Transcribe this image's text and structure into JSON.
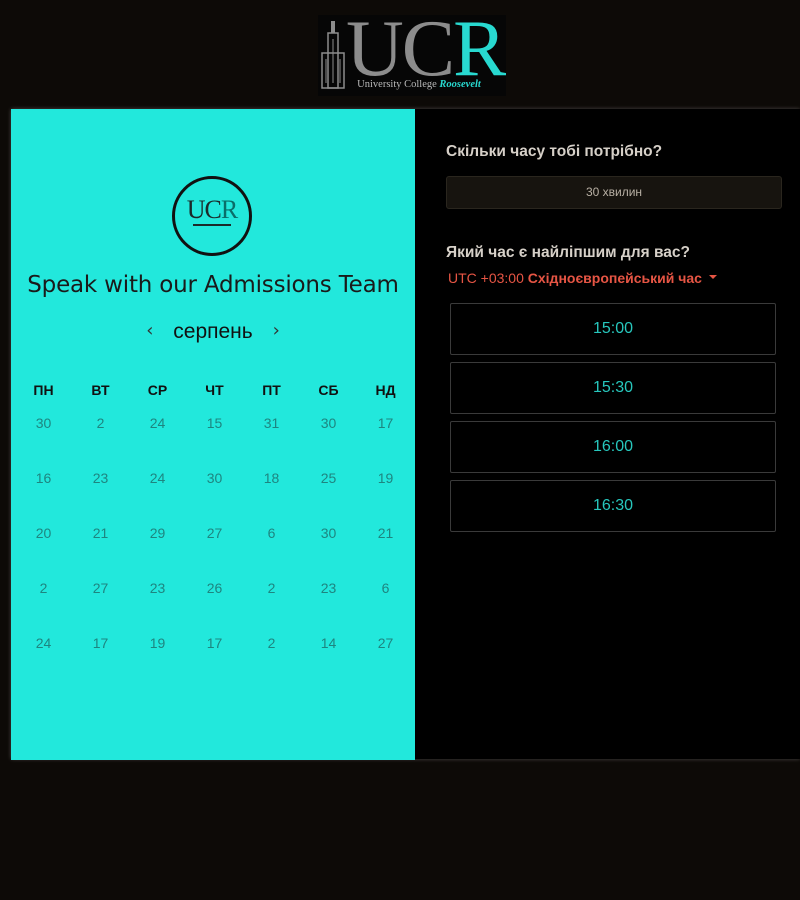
{
  "header": {
    "logo_letters_uc": "UC",
    "logo_letters_r": "R",
    "logo_tagline": "University College",
    "logo_tagline_accent": "Roosevelt"
  },
  "scheduler": {
    "badge_letters_uc": "UC",
    "badge_letters_r": "R",
    "title": "Speak with our Admissions Team",
    "month": "серпень",
    "prev_icon": "chevron-left",
    "next_icon": "chevron-right",
    "weekdays": [
      "ПН",
      "ВТ",
      "СР",
      "ЧТ",
      "ПТ",
      "СБ",
      "НД"
    ],
    "weeks": [
      [
        "30",
        "2",
        "24",
        "15",
        "31",
        "30",
        "17"
      ],
      [
        "16",
        "23",
        "24",
        "30",
        "18",
        "25",
        "19"
      ],
      [
        "20",
        "21",
        "29",
        "27",
        "6",
        "30",
        "21"
      ],
      [
        "2",
        "27",
        "23",
        "26",
        "2",
        "23",
        "6"
      ],
      [
        "24",
        "17",
        "19",
        "17",
        "2",
        "14",
        "27"
      ]
    ]
  },
  "booking": {
    "duration_question": "Скільки часу тобі потрібно?",
    "duration_value": "30 хвилин",
    "time_question": "Який час є найліпшим для вас?",
    "timezone_offset": "UTC +03:00",
    "timezone_name": "Східноєвропейський час",
    "slots": [
      "15:00",
      "15:30",
      "16:00",
      "16:30"
    ]
  },
  "colors": {
    "page_bg": "#0d0a07",
    "calendar_bg": "#22e8dc",
    "accent_teal": "#27c7bd",
    "timezone_red": "#e65544"
  }
}
